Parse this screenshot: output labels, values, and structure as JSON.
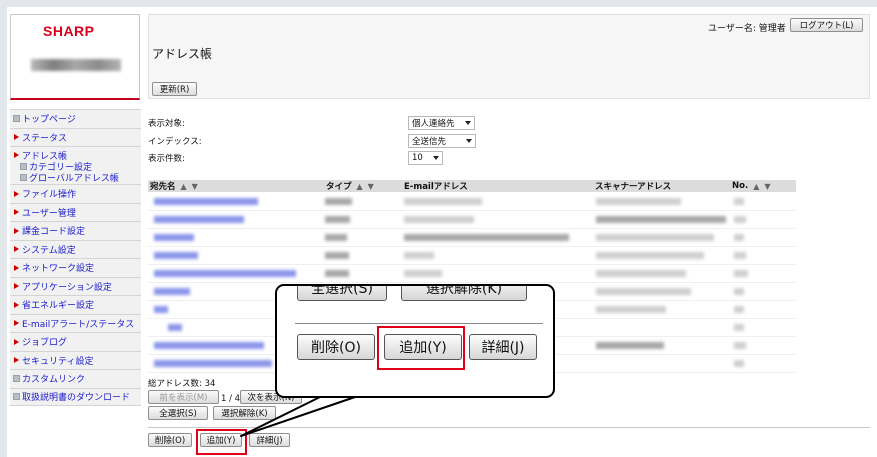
{
  "header": {
    "brand": "SHARP",
    "user_label": "ユーザー名: 管理者",
    "logout_button": "ログアウト(L)",
    "page_title": "アドレス帳",
    "refresh_button": "更新(R)"
  },
  "sidebar": {
    "items": [
      {
        "label": "トップページ",
        "marker": "square"
      },
      {
        "label": "ステータス",
        "marker": "triangle"
      },
      {
        "label": "アドレス帳",
        "marker": "triangle",
        "children": [
          "カテゴリー設定",
          "グローバルアドレス帳"
        ]
      },
      {
        "label": "ファイル操作",
        "marker": "triangle"
      },
      {
        "label": "ユーザー管理",
        "marker": "triangle"
      },
      {
        "label": "課金コード設定",
        "marker": "triangle"
      },
      {
        "label": "システム設定",
        "marker": "triangle"
      },
      {
        "label": "ネットワーク設定",
        "marker": "triangle"
      },
      {
        "label": "アプリケーション設定",
        "marker": "triangle"
      },
      {
        "label": "省エネルギー設定",
        "marker": "triangle"
      },
      {
        "label": "E-mailアラート/ステータス",
        "marker": "triangle"
      },
      {
        "label": "ジョブログ",
        "marker": "triangle"
      },
      {
        "label": "セキュリティ設定",
        "marker": "triangle"
      },
      {
        "label": "カスタムリンク",
        "marker": "square"
      },
      {
        "label": "取扱説明書のダウンロード",
        "marker": "square"
      }
    ]
  },
  "filters": {
    "display_target_label": "表示対象:",
    "display_target_value": "個人連絡先",
    "index_label": "インデックス:",
    "index_value": "全送信先",
    "count_label": "表示件数:",
    "count_value": "10"
  },
  "table": {
    "columns": [
      "宛先名",
      "タイプ",
      "E-mailアドレス",
      "スキャナーアドレス",
      "No."
    ],
    "sort_up": "▲",
    "sort_down": "▼"
  },
  "footer": {
    "total_label": "総アドレス数: 34",
    "prev_button": "前を表示(M)",
    "page_info": "1 / 4",
    "next_button": "次を表示(N)",
    "select_all_button": "全選択(S)",
    "deselect_button": "選択解除(K)",
    "delete_button": "削除(O)",
    "add_button": "追加(Y)",
    "detail_button": "詳細(J)"
  },
  "callout": {
    "top_left_button": "全選択(S)",
    "top_right_button": "選択解除(K)",
    "delete_button": "削除(O)",
    "add_button": "追加(Y)",
    "detail_button": "詳細(J)"
  },
  "colors": {
    "brand_red": "#d9001b",
    "highlight": "#e0001a",
    "link_blue": "#1a1acb"
  }
}
